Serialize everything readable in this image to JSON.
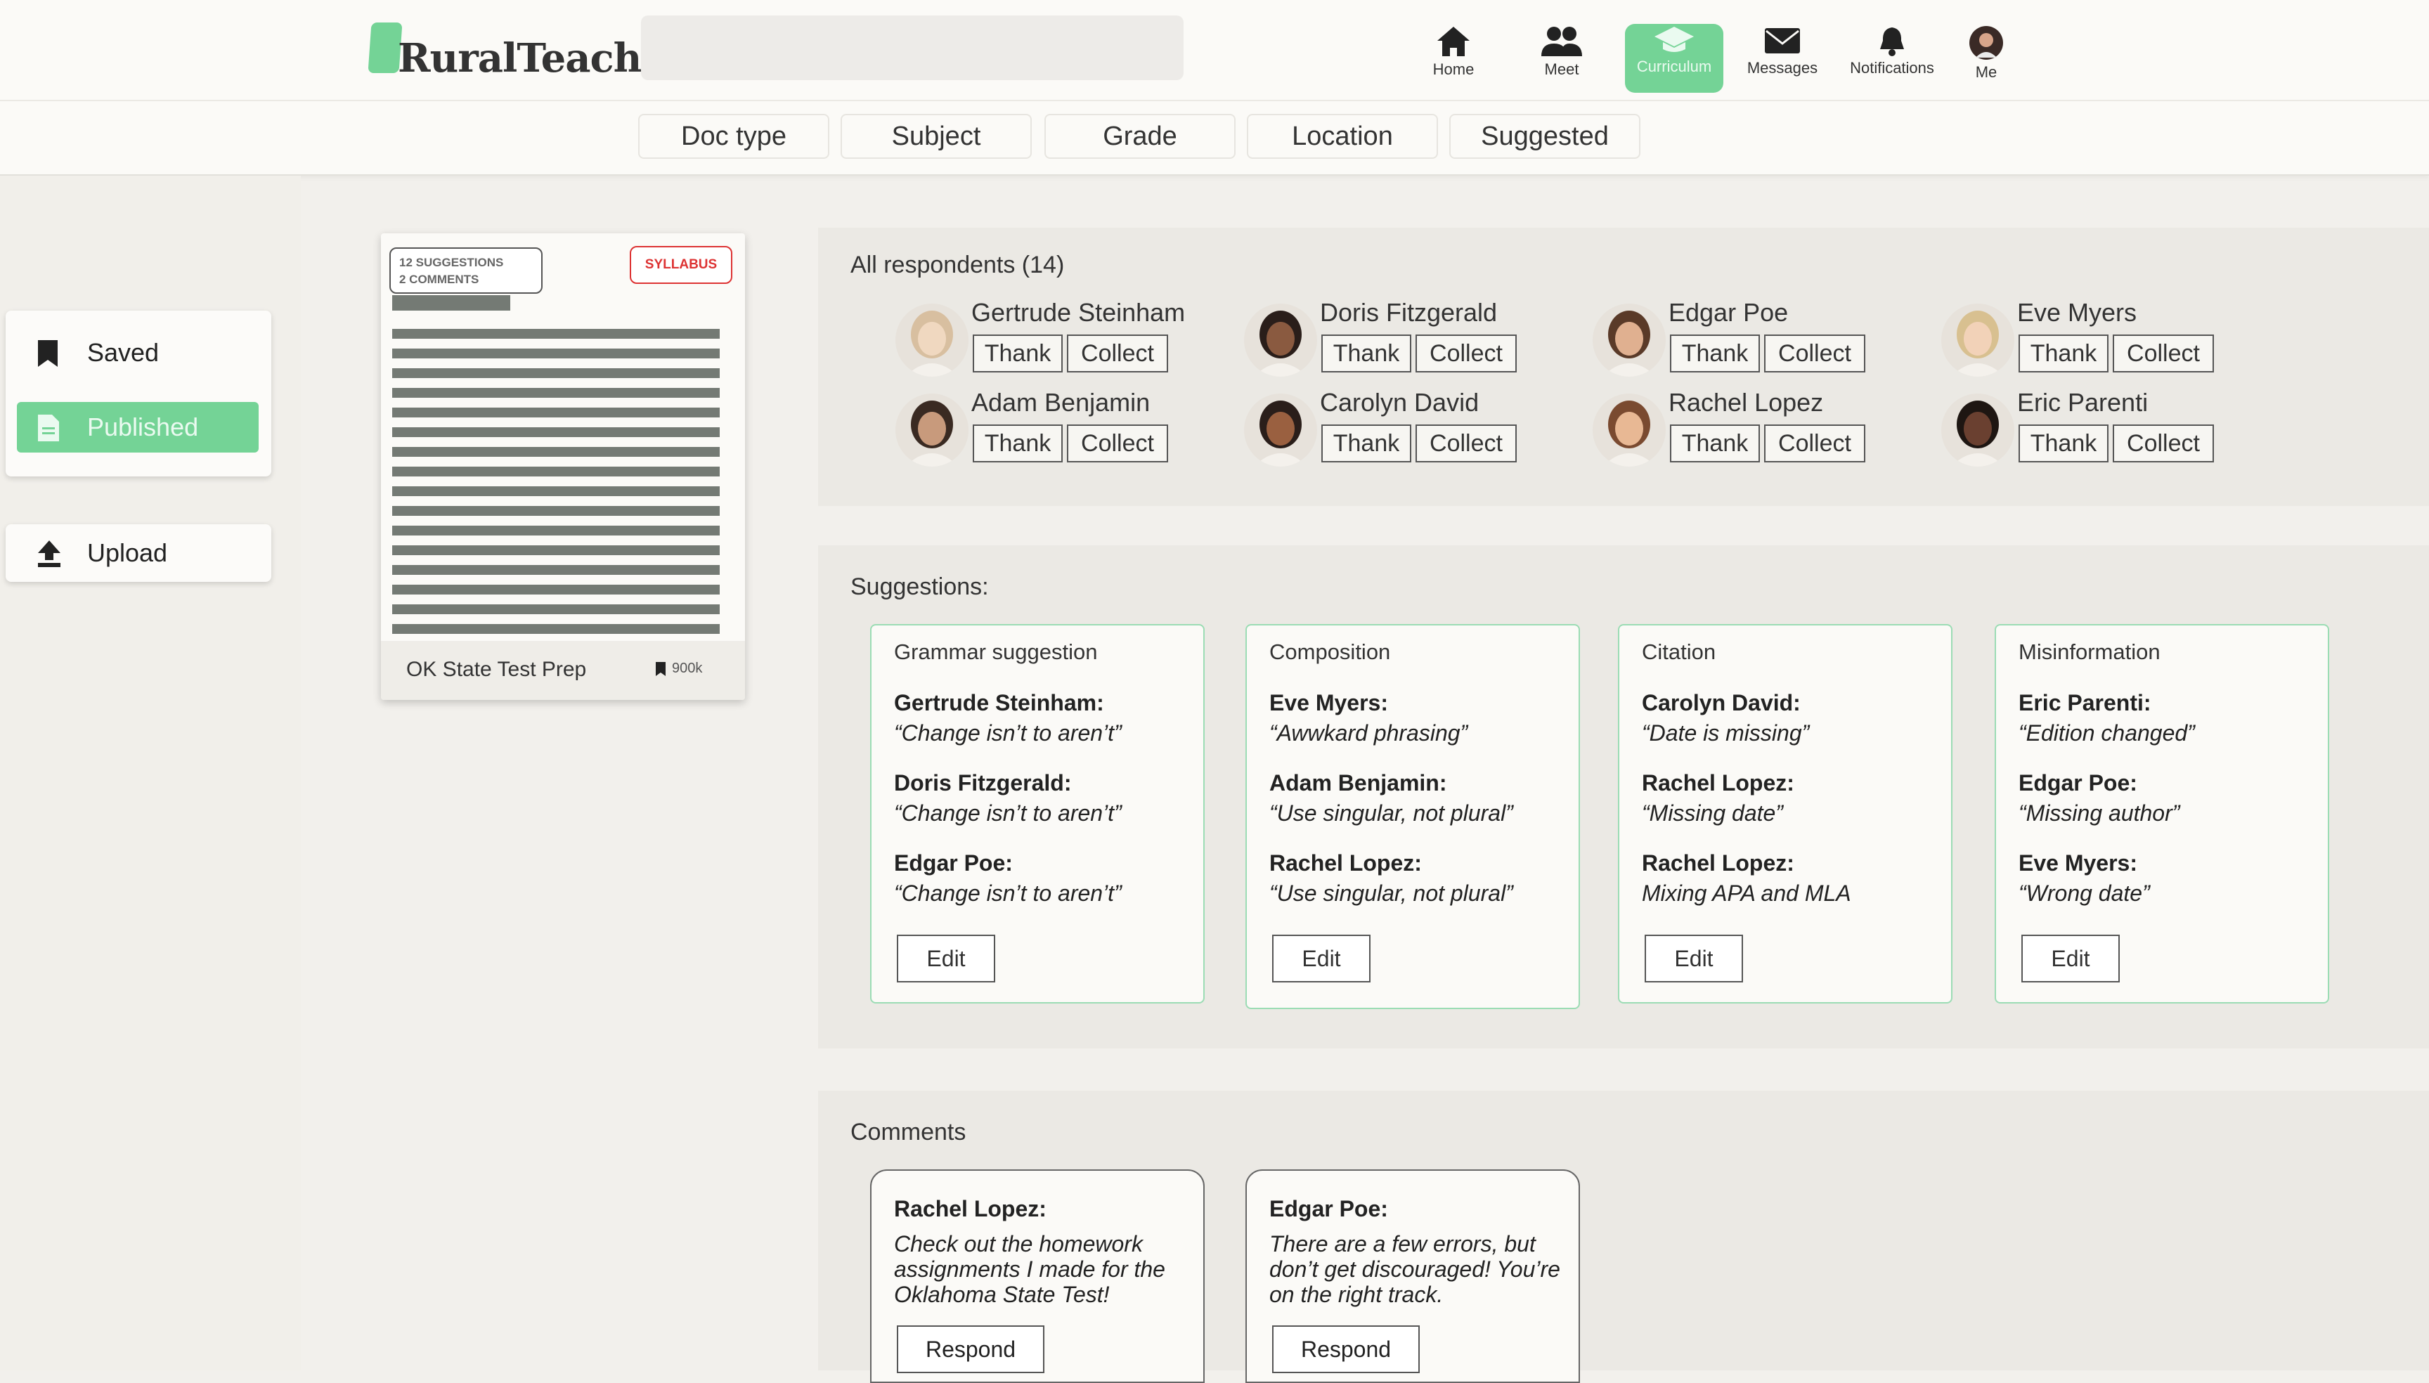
{
  "app": {
    "name": "RuralTeach"
  },
  "nav": {
    "home": "Home",
    "meet": "Meet",
    "curriculum": "Curriculum",
    "messages": "Messages",
    "notifications": "Notifications",
    "me": "Me"
  },
  "filters": [
    "Doc type",
    "Subject",
    "Grade",
    "Location",
    "Suggested"
  ],
  "sidebar": {
    "saved": "Saved",
    "published": "Published",
    "upload": "Upload"
  },
  "document": {
    "suggestions": "12 SUGGESTIONS",
    "comments": "2 COMMENTS",
    "type": "SYLLABUS",
    "title": "OK State Test Prep",
    "saves": "900k"
  },
  "respondents": {
    "title": "All respondents (14)",
    "thank_label": "Thank",
    "collect_label": "Collect",
    "people": [
      "Gertrude Steinham",
      "Doris Fitzgerald",
      "Edgar Poe",
      "Eve Myers",
      "Adam Benjamin",
      "Carolyn David",
      "Rachel Lopez",
      "Eric Parenti"
    ]
  },
  "suggestions": {
    "title": "Suggestions:",
    "edit_label": "Edit",
    "cards": [
      {
        "category": "Grammar suggestion",
        "items": [
          {
            "who": "Gertrude Steinham:",
            "text": "“Change isn’t to aren’t”"
          },
          {
            "who": "Doris Fitzgerald:",
            "text": "“Change isn’t to aren’t”"
          },
          {
            "who": "Edgar Poe:",
            "text": "“Change isn’t to aren’t”"
          }
        ]
      },
      {
        "category": "Composition",
        "items": [
          {
            "who": "Eve Myers:",
            "text": "“Awwkard phrasing”"
          },
          {
            "who": "Adam Benjamin:",
            "text": "“Use singular, not plural”"
          },
          {
            "who": "Rachel Lopez:",
            "text": "“Use singular, not plural”"
          }
        ]
      },
      {
        "category": "Citation",
        "items": [
          {
            "who": "Carolyn David:",
            "text": "“Date is missing”"
          },
          {
            "who": "Rachel Lopez:",
            "text": "“Missing date”"
          },
          {
            "who": "Rachel Lopez:",
            "text": "Mixing APA and MLA"
          }
        ]
      },
      {
        "category": "Misinformation",
        "items": [
          {
            "who": "Eric Parenti:",
            "text": "“Edition changed”"
          },
          {
            "who": "Edgar Poe:",
            "text": "“Missing author”"
          },
          {
            "who": "Eve Myers:",
            "text": "“Wrong date”"
          }
        ]
      }
    ]
  },
  "comments": {
    "title": "Comments",
    "respond_label": "Respond",
    "cards": [
      {
        "who": "Rachel Lopez:",
        "text": "Check out the homework assignments I made for the Oklahoma State Test!"
      },
      {
        "who": "Edgar Poe:",
        "text": "There are a few errors, but don’t get discouraged! You’re on the right track."
      }
    ]
  },
  "colors": {
    "accent": "#74d396",
    "syllabus": "#d33333",
    "card_border": "#9bdcb4"
  }
}
